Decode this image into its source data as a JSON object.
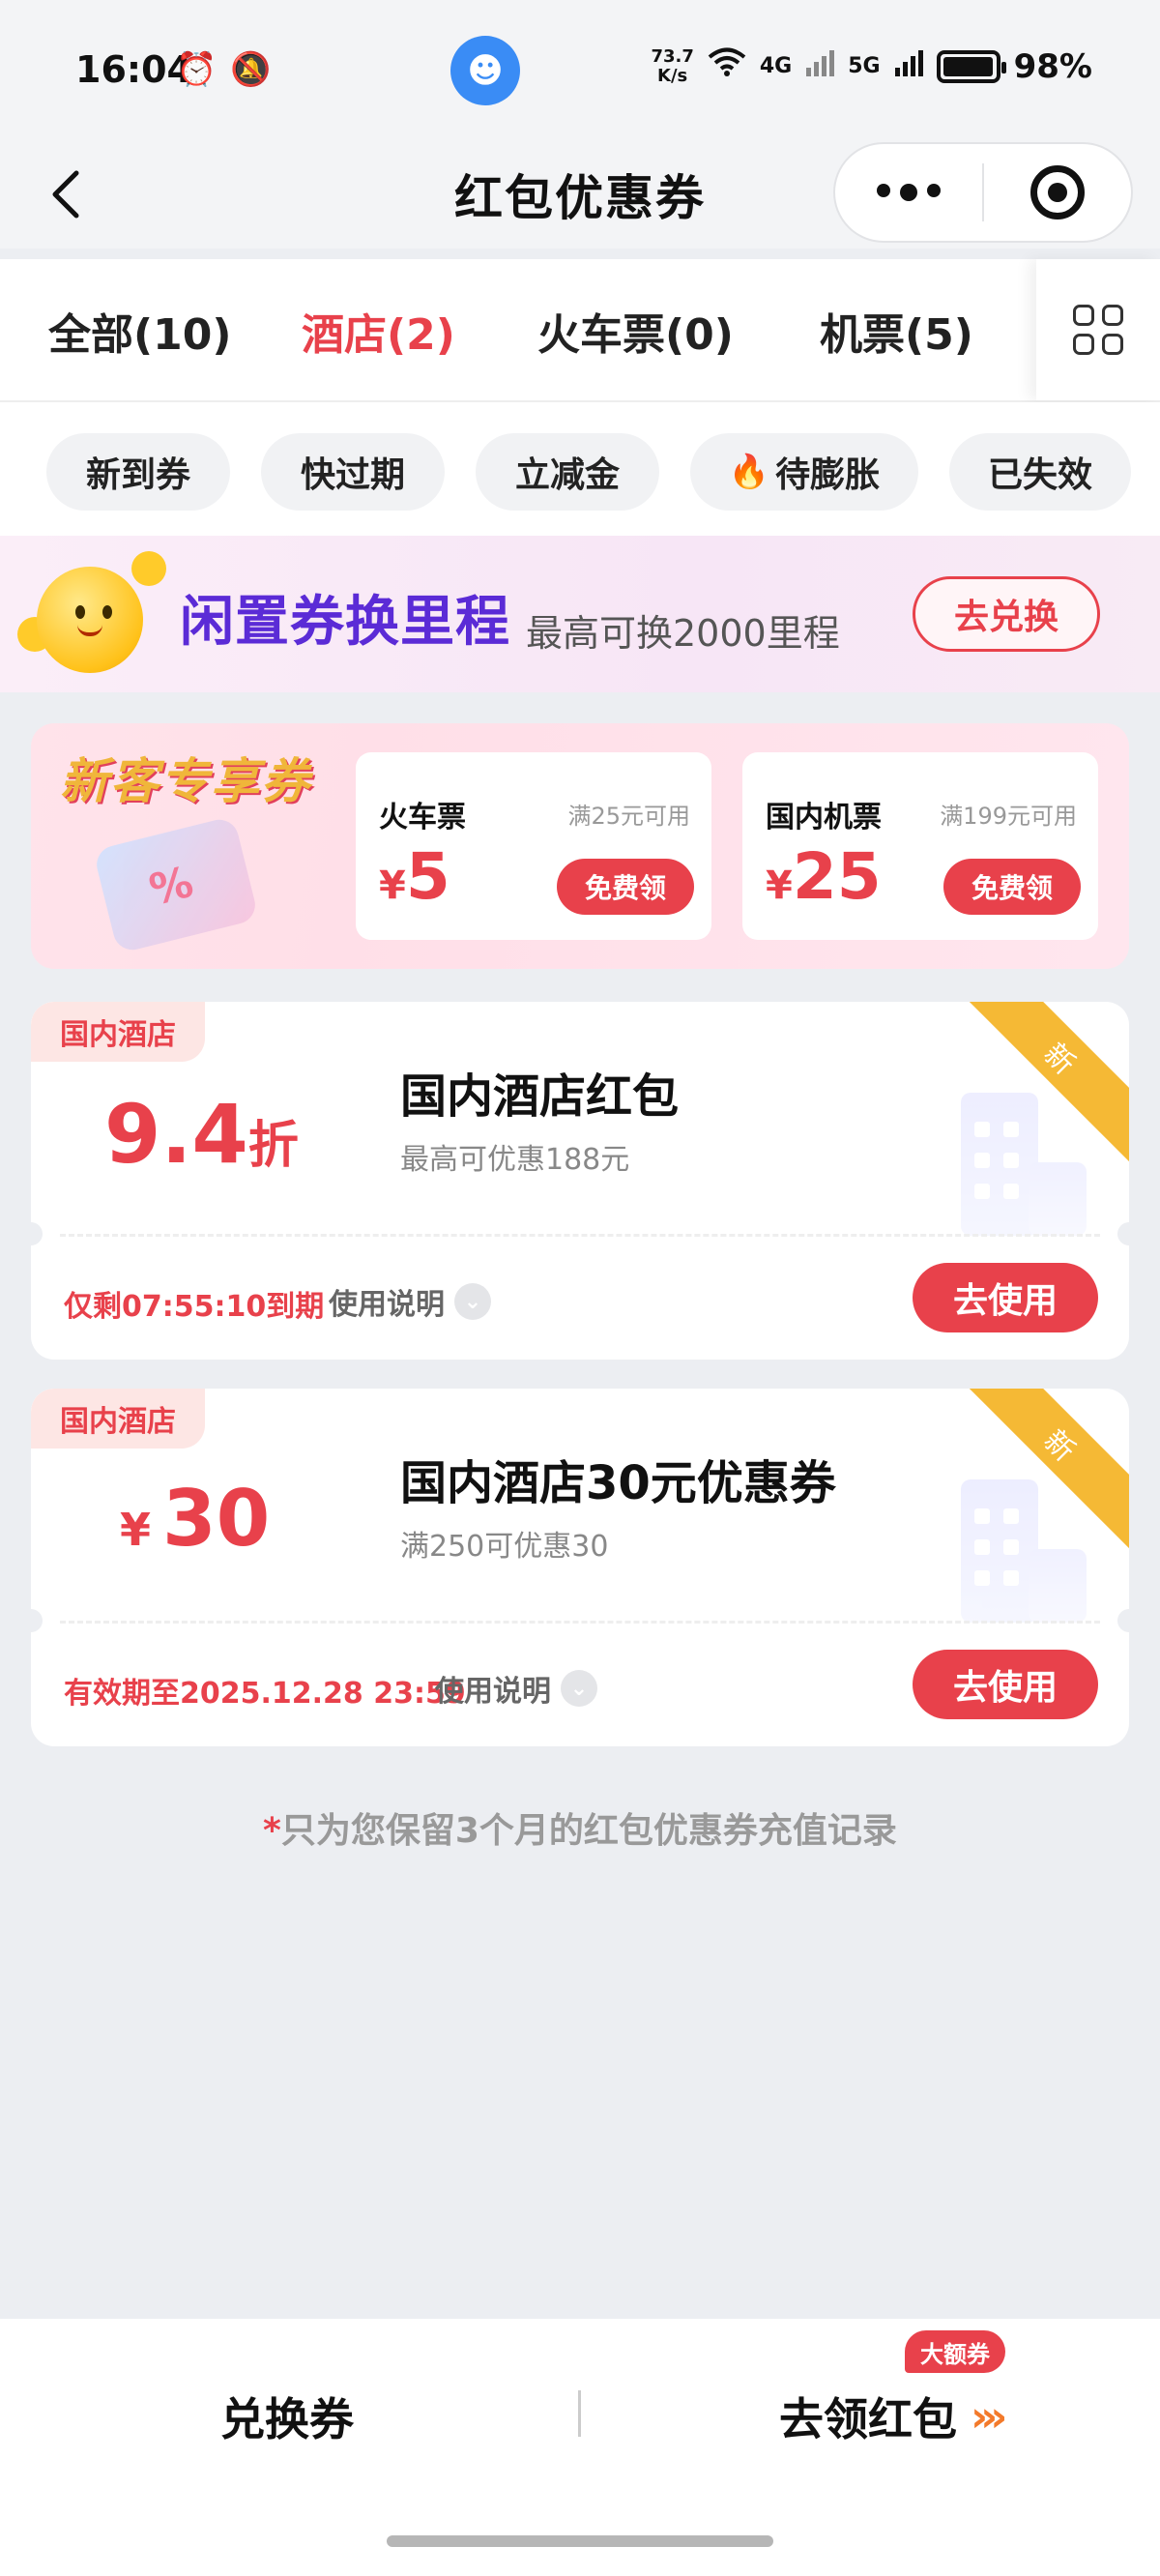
{
  "status": {
    "time": "16:04",
    "net_speed_value": "73.7",
    "net_speed_unit": "K/s",
    "signal_4g": "4G",
    "signal_5g": "5G",
    "battery": "98%",
    "battery_level": 0.98
  },
  "nav": {
    "title": "红包优惠券"
  },
  "tabs": [
    {
      "label": "全部(10)"
    },
    {
      "label": "酒店(2)"
    },
    {
      "label": "火车票(0)"
    },
    {
      "label": "机票(5)"
    }
  ],
  "chips": [
    {
      "label": "新到券"
    },
    {
      "label": "快过期"
    },
    {
      "label": "立减金"
    },
    {
      "label": "待膨胀"
    },
    {
      "label": "已失效"
    }
  ],
  "promo": {
    "title": "闲置券换里程",
    "subtitle": "最高可换2000里程",
    "button": "去兑换"
  },
  "newbie": {
    "title": "新客专享券",
    "cards": [
      {
        "name": "火车票",
        "condition": "满25元可用",
        "currency": "¥",
        "amount": "5",
        "button": "免费领"
      },
      {
        "name": "国内机票",
        "condition": "满199元可用",
        "currency": "¥",
        "amount": "25",
        "button": "免费领"
      }
    ]
  },
  "coupons": [
    {
      "tag": "国内酒店",
      "badge": "新",
      "value_num": "9.4",
      "value_unit": "折",
      "name": "国内酒店红包",
      "desc": "最高可优惠188元",
      "expire": "仅剩07:55:10到期",
      "usage": "使用说明",
      "button": "去使用"
    },
    {
      "tag": "国内酒店",
      "badge": "新",
      "value_currency": "¥",
      "value_num": "30",
      "name": "国内酒店30元优惠券",
      "desc": "满250可优惠30",
      "expire": "有效期至2025.12.28 23:59",
      "usage": "使用说明",
      "button": "去使用"
    }
  ],
  "footnote": {
    "star": "*",
    "text": "只为您保留3个月的红包优惠券充值记录"
  },
  "bottom": {
    "left": "兑换券",
    "right": "去领红包",
    "badge": "大额券"
  },
  "colors": {
    "accent": "#e8414b",
    "ribbon": "#f5b935",
    "background": "#eceef2"
  }
}
